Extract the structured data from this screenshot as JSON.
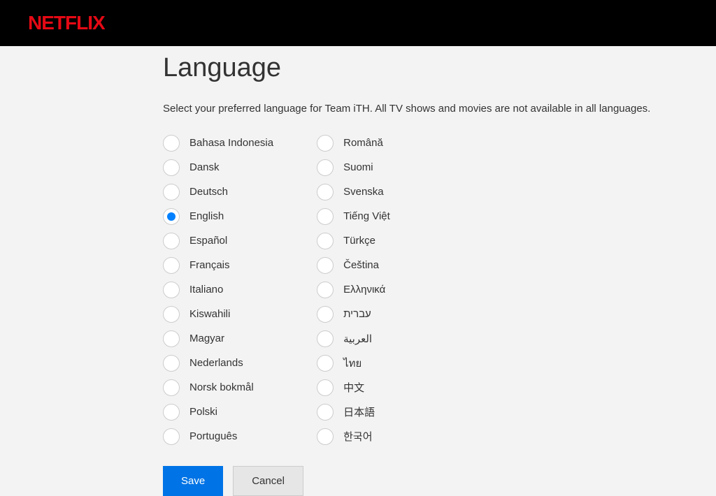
{
  "header": {
    "logo": "NETFLIX"
  },
  "page": {
    "title": "Language",
    "subtitle": "Select your preferred language for Team iTH. All TV shows and movies are not available in all languages."
  },
  "languages_col1": [
    {
      "label": "Bahasa Indonesia",
      "selected": false
    },
    {
      "label": "Dansk",
      "selected": false
    },
    {
      "label": "Deutsch",
      "selected": false
    },
    {
      "label": "English",
      "selected": true
    },
    {
      "label": "Español",
      "selected": false
    },
    {
      "label": "Français",
      "selected": false
    },
    {
      "label": "Italiano",
      "selected": false
    },
    {
      "label": "Kiswahili",
      "selected": false
    },
    {
      "label": "Magyar",
      "selected": false
    },
    {
      "label": "Nederlands",
      "selected": false
    },
    {
      "label": "Norsk bokmål",
      "selected": false
    },
    {
      "label": "Polski",
      "selected": false
    },
    {
      "label": "Português",
      "selected": false
    }
  ],
  "languages_col2": [
    {
      "label": "Română",
      "selected": false
    },
    {
      "label": "Suomi",
      "selected": false
    },
    {
      "label": "Svenska",
      "selected": false
    },
    {
      "label": "Tiếng Việt",
      "selected": false
    },
    {
      "label": "Türkçe",
      "selected": false
    },
    {
      "label": "Čeština",
      "selected": false
    },
    {
      "label": "Ελληνικά",
      "selected": false
    },
    {
      "label": "עברית",
      "selected": false
    },
    {
      "label": "العربية",
      "selected": false
    },
    {
      "label": "ไทย",
      "selected": false
    },
    {
      "label": "中文",
      "selected": false
    },
    {
      "label": "日本語",
      "selected": false
    },
    {
      "label": "한국어",
      "selected": false
    }
  ],
  "buttons": {
    "save": "Save",
    "cancel": "Cancel"
  }
}
